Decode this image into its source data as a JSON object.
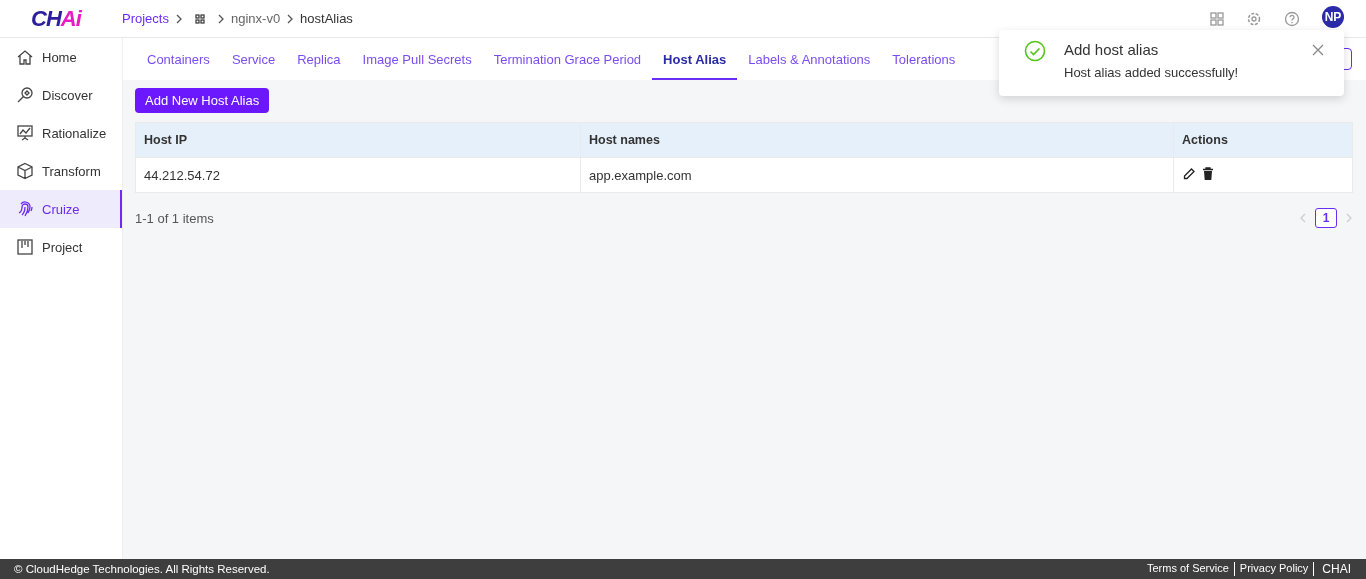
{
  "logo": {
    "left": "CH",
    "right": "Ai"
  },
  "breadcrumb": [
    {
      "label": "Projects",
      "kind": "link"
    },
    {
      "kind": "grid"
    },
    {
      "label": "nginx-v0",
      "kind": "plain"
    },
    {
      "label": "hostAlias",
      "kind": "current"
    }
  ],
  "user": {
    "initials": "NP"
  },
  "sidebar": {
    "items": [
      {
        "label": "Home",
        "selected": false
      },
      {
        "label": "Discover",
        "selected": false
      },
      {
        "label": "Rationalize",
        "selected": false
      },
      {
        "label": "Transform",
        "selected": false
      },
      {
        "label": "Cruize",
        "selected": true
      },
      {
        "label": "Project",
        "selected": false
      }
    ]
  },
  "tabs": [
    {
      "label": "Containers",
      "selected": false
    },
    {
      "label": "Service",
      "selected": false
    },
    {
      "label": "Replica",
      "selected": false
    },
    {
      "label": "Image Pull Secrets",
      "selected": false
    },
    {
      "label": "Termination Grace Period",
      "selected": false
    },
    {
      "label": "Host Alias",
      "selected": true
    },
    {
      "label": "Labels & Annotations",
      "selected": false
    },
    {
      "label": "Tolerations",
      "selected": false
    }
  ],
  "add_button": "Add New Host Alias",
  "table": {
    "columns": [
      "Host IP",
      "Host names",
      "Actions"
    ],
    "rows": [
      {
        "host_ip": "44.212.54.72",
        "host_names": "app.example.com"
      }
    ]
  },
  "pagination": {
    "summary": "1-1 of 1 items",
    "pages": [
      {
        "label": "1",
        "selected": true
      }
    ]
  },
  "toast": {
    "title": "Add host alias",
    "message": "Host alias added successfully!"
  },
  "footer": {
    "copyright": "© CloudHedge Technologies. All Rights Reserved.",
    "links": [
      "Terms of Service",
      "Privacy Policy",
      "CHAI"
    ]
  }
}
